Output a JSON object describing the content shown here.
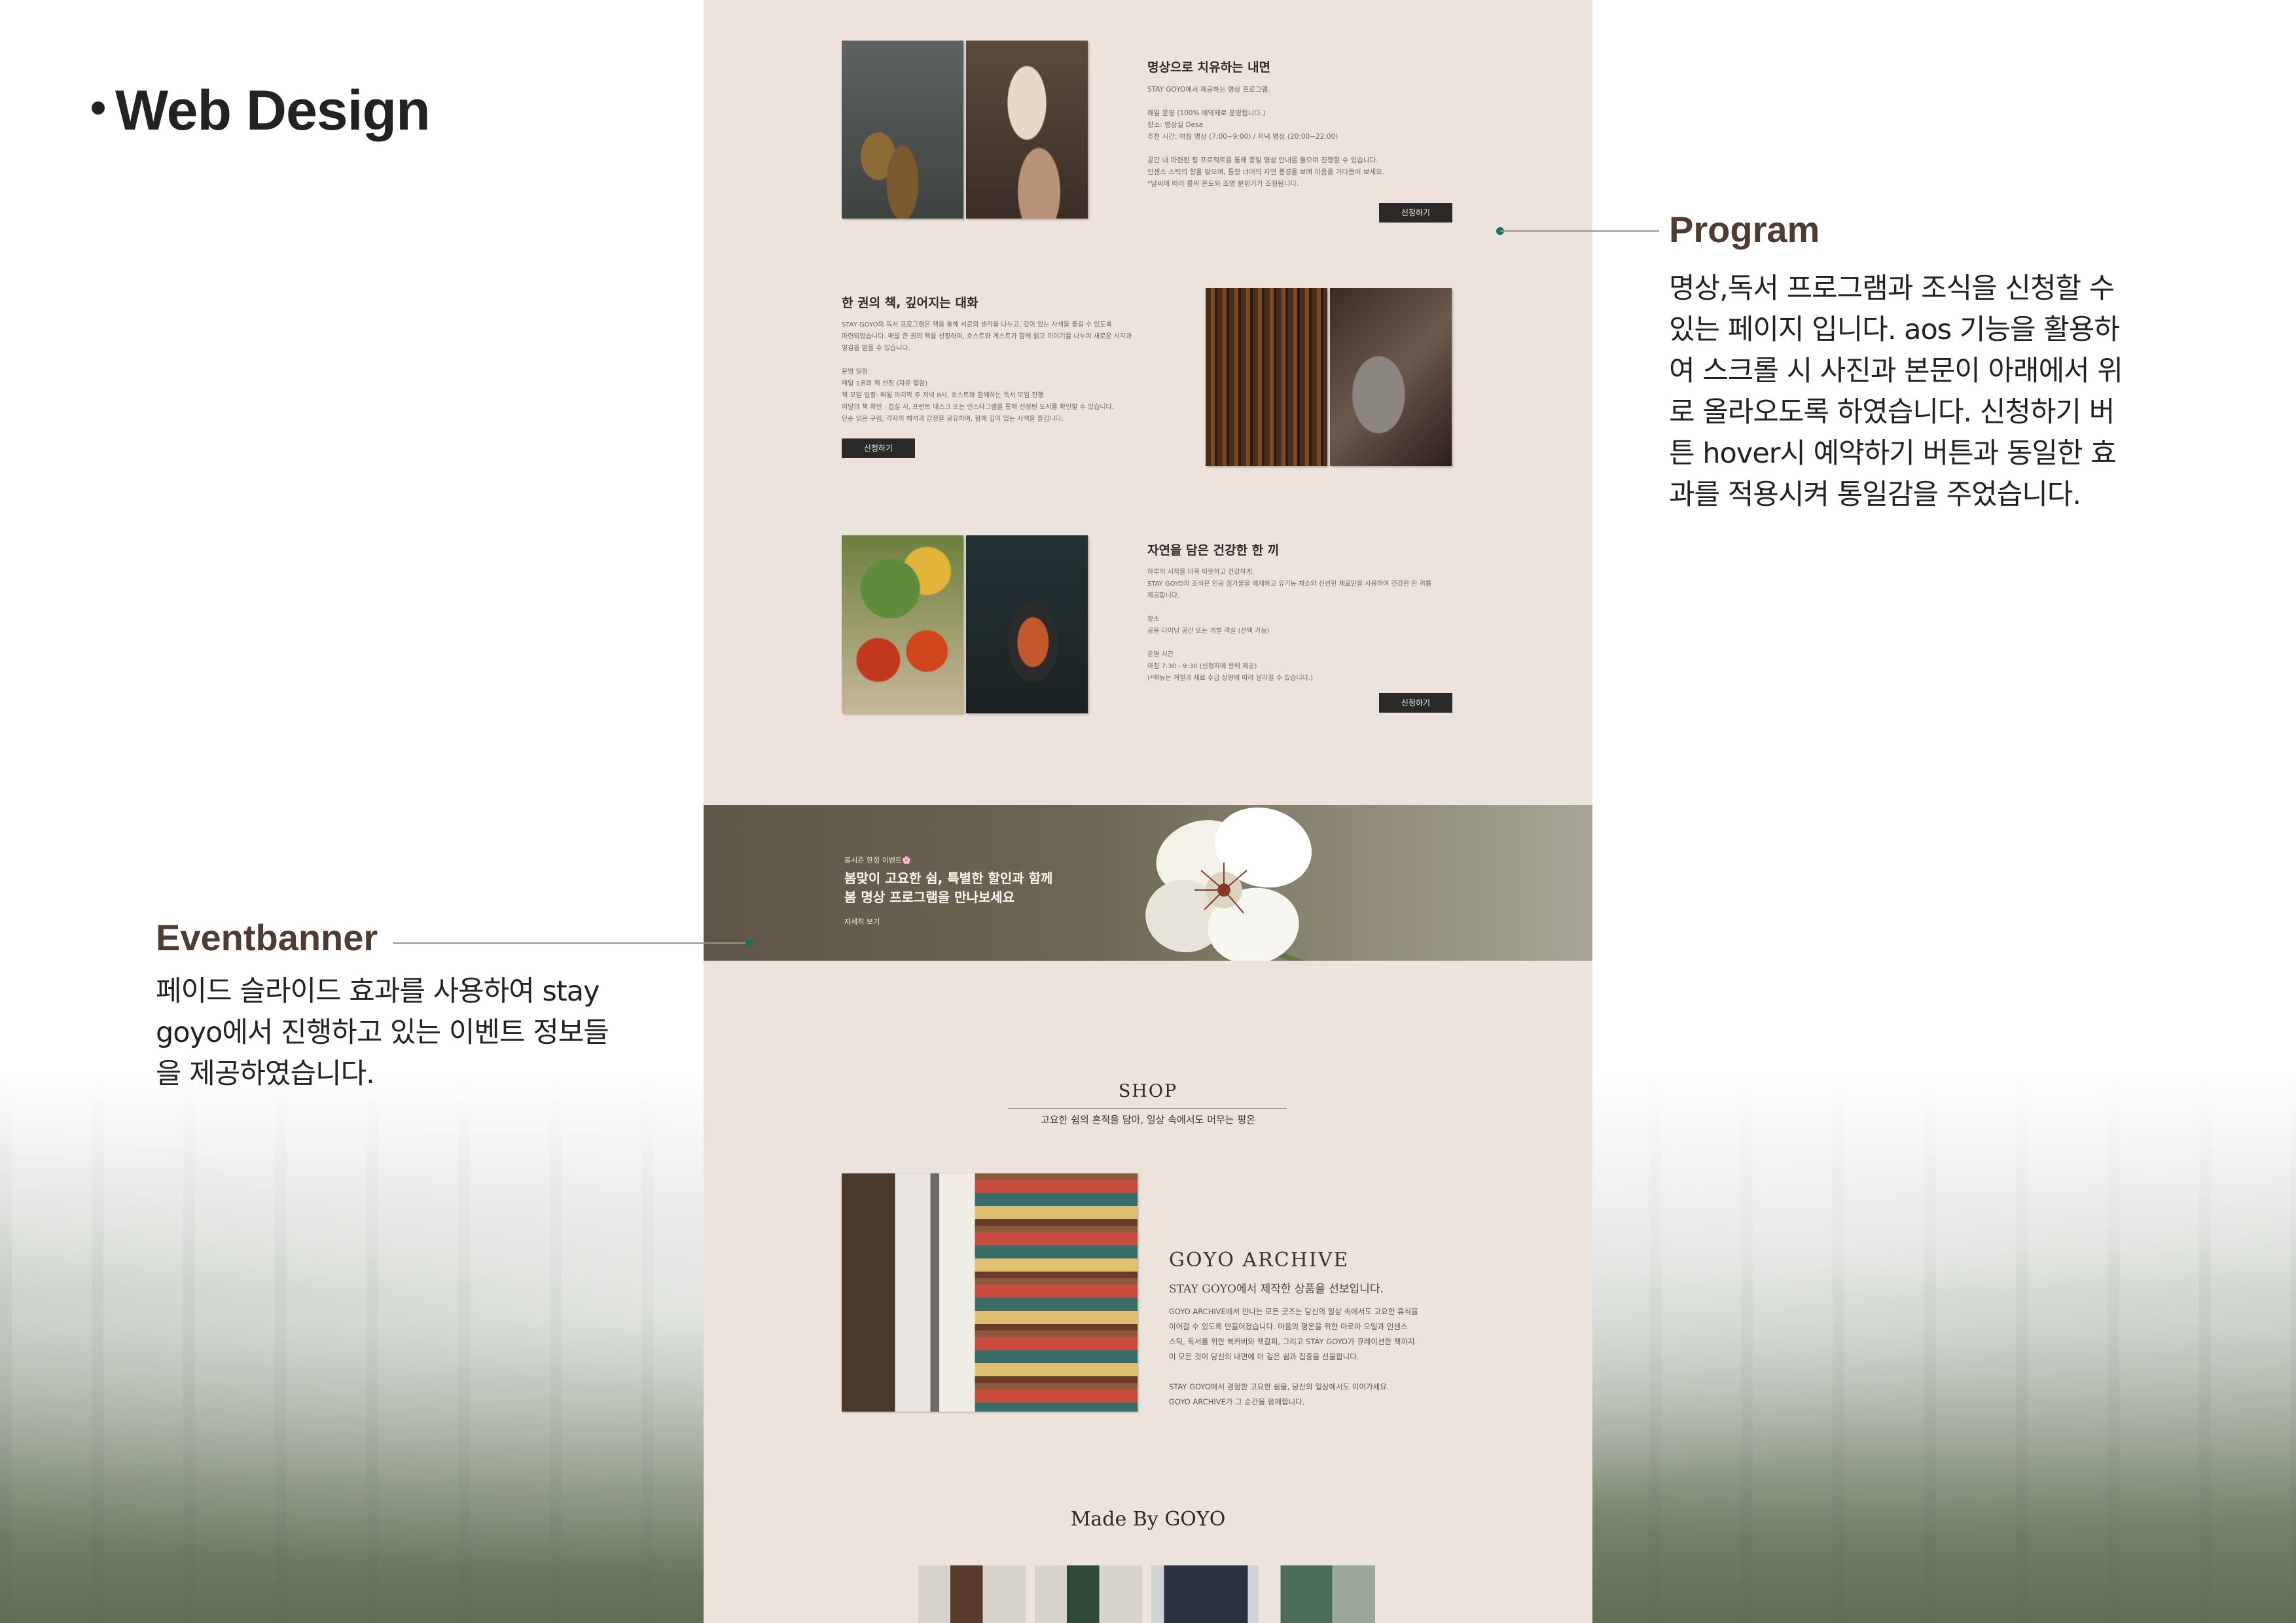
{
  "heading": "Web Design",
  "program": {
    "label": "Program",
    "description": "명상,독서 프로그램과 조식을 신청할 수\n있는 페이지 입니다. aos 기능을 활용하\n여 스크롤 시 사진과 본문이 아래에서 위\n로 올라오도록 하였습니다.  신청하기 버\n튼 hover시 예약하기 버튼과 동일한 효\n과를 적용시켜 통일감을 주었습니다."
  },
  "eventbanner": {
    "label": "Eventbanner",
    "description": "페이드 슬라이드 효과를 사용하여 stay\ngoyo에서 진행하고 있는 이벤트 정보들\n을 제공하였습니다."
  },
  "site": {
    "programs": [
      {
        "title": "명상으로 치유하는 내면",
        "body": "STAY GOYO에서 제공하는 명상 프로그램.\n\n매일 운영 (100% 예약제로 운영됩니다.)\n장소: 명상실 Desa\n추천 시간: 아침 명상 (7:00~9:00) / 저녁 명상 (20:00~22:00)\n\n공간 내 마련된 핑 프로젝트를 통해 종일 명상 안내를 들으며 진행할 수 있습니다.\n인센스 스틱의 향을 맡으며, 통창 너머의 자연 풍경을 보며 마음을 가다듬어 보세요.\n*날씨에 따라 룸의 온도와 조명 분위기가 조정됩니다.",
        "button": "신청하기"
      },
      {
        "title": "한 권의 책, 깊어지는 대화",
        "body": "STAY GOYO의 독서 프로그램은 책을 통해 서로의 생각을 나누고, 깊이 있는 사색을 즐길 수 있도록\n마련되었습니다. 매달 한 권의 책을 선정하여, 호스트와 게스트가 함께 읽고 이야기를 나누며 새로운 시각과\n영감을 얻을 수 있습니다.\n\n운영 일정\n매달 1권의 책 선정 (자유 열람)\n책 모임 일정: 매월 마지막 주 저녁 8시, 호스트와 함께하는 독서 모임 진행\n이달의 책 확인 · 접실 시, 프런트 데스크 또는 인스타그램을 통해 선정된 도서를 확인할 수 있습니다.\n단순 읽은 구림, 각자의 해석과 감정을 공유하며, 함께 깊이 있는 사색을 즐깁니다.",
        "button": "신청하기"
      },
      {
        "title": "자연을 담은 건강한 한 끼",
        "body": "하루의 시작을 더욱 따뜻하고 건강하게.\nSTAY GOYO의 조식은 인공 첨가물을 배제하고 유기농 채소와 신선한 재료만을 사용하여 건강한 한 끼를\n제공합니다.\n\n장소\n공용 다이닝 공간 또는 개별 객실 (선택 가능)\n\n운영 시간\n아침 7:30 - 9:30 (신청자에 한해 제공)\n(*메뉴는 계절과 재료 수급 상황에 따라 달라질 수 있습니다.)",
        "button": "신청하기"
      }
    ],
    "banner": {
      "small": "봄시즌 한정 이벤트🌸",
      "title": "봄맞이 고요한 쉼, 특별한 할인과 함께\n봄 명상 프로그램을 만나보세요",
      "link": "자세히 보기"
    },
    "shop": {
      "title": "SHOP",
      "subtitle": "고요한 쉼의 흔적을 담아, 일상 속에서도 머무는 평온",
      "archive_title": "GOYO ARCHIVE",
      "archive_sub": "STAY GOYO에서 제작한 상품을 선보입니다.",
      "archive_body": "GOYO ARCHIVE에서 만나는 모든 굿즈는 당신의 일상 속에서도 고요한 휴식을\n이어갈 수 있도록 만들어졌습니다. 마음의 평온을 위한 아로마 오일과 인센스\n스틱, 독서를 위한 북커버와 책갈피, 그리고 STAY GOYO가 큐레이션한 책까지.\n이 모든 것이 당신의 내면에 더 깊은 쉼과 집중을 선물합니다.\n\nSTAY GOYO에서 경험한 고요한 쉼을, 당신의 일상에서도 이어가세요.\nGOYO ARCHIVE가 그 순간을 함께합니다.",
      "made_by": "Made By GOYO"
    }
  },
  "colors": {
    "page_bg": "#ece3dd",
    "accent_dot": "#1e6e5e",
    "button_bg": "#2c2a28",
    "annotation_title": "#4e3c32"
  }
}
